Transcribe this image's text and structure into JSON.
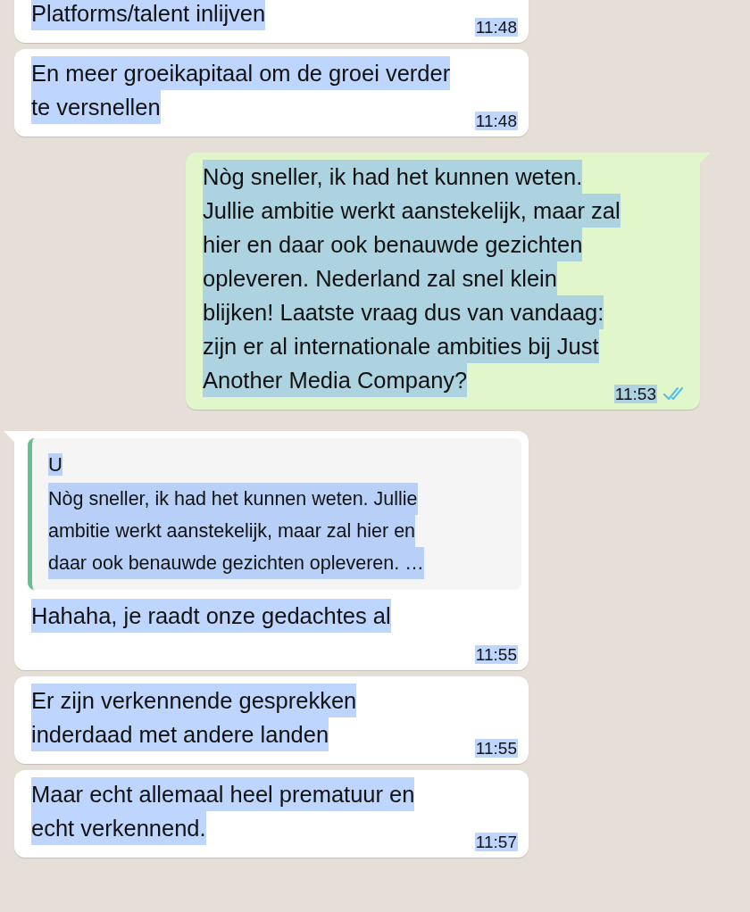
{
  "messages": [
    {
      "kind": "in",
      "lines": [
        "Platforms/talent inlijven"
      ],
      "time": "11:48",
      "selected": true
    },
    {
      "kind": "in",
      "lines": [
        "En meer groeikapitaal om de groei verder",
        "te versnellen"
      ],
      "time": "11:48",
      "selected": true
    },
    {
      "kind": "out",
      "lines": [
        "Nòg sneller, ik had het kunnen weten.",
        "Jullie ambitie werkt aanstekelijk, maar zal",
        "hier en daar ook benauwde gezichten",
        "opleveren. Nederland zal snel klein",
        "blijken! Laatste vraag dus van vandaag:",
        "zijn er al internationale ambities bij Just",
        "Another Media Company?"
      ],
      "time": "11:53",
      "selected": true,
      "read": true
    },
    {
      "kind": "in",
      "quote": {
        "author": "U",
        "lines": [
          "Nòg sneller, ik had het kunnen weten. Jullie",
          "ambitie werkt aanstekelijk, maar zal hier en",
          "daar ook benauwde gezichten opleveren. …"
        ]
      },
      "lines": [
        "Hahaha, je raadt onze gedachtes al"
      ],
      "time": "11:55",
      "selected": true
    },
    {
      "kind": "in",
      "lines": [
        "Er zijn verkennende gesprekken",
        "inderdaad met andere landen"
      ],
      "time": "11:55",
      "selected": true
    },
    {
      "kind": "in",
      "lines": [
        "Maar echt allemaal heel prematuur en",
        "echt verkennend."
      ],
      "time": "11:57",
      "selected": true
    }
  ]
}
